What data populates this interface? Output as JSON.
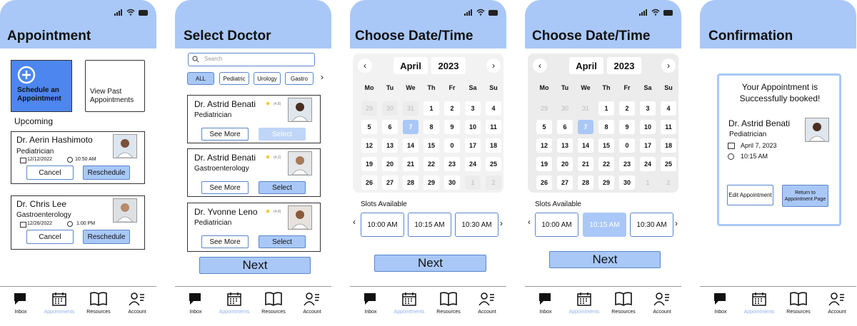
{
  "nav": [
    {
      "label": "Inbox",
      "icon": "inbox-icon"
    },
    {
      "label": "Appointments",
      "icon": "calendar-icon"
    },
    {
      "label": "Resources",
      "icon": "book-icon"
    },
    {
      "label": "Account",
      "icon": "account-icon"
    }
  ],
  "screen1": {
    "title": "Appointment",
    "schedule_label": "Schedule an Appointment",
    "past_label": "View Past Appointments",
    "upcoming_label": "Upcoming",
    "appointments": [
      {
        "doctor": "Dr. Aerin Hashimoto",
        "specialty": "Pediatrician",
        "date": "12/12/2022",
        "time": "10:50 AM",
        "cancel": "Cancel",
        "reschedule": "Reschedule"
      },
      {
        "doctor": "Dr. Chris Lee",
        "specialty": "Gastroenterology",
        "date": "12/26/2022",
        "time": "1:00 PM",
        "cancel": "Cancel",
        "reschedule": "Reschedule"
      }
    ]
  },
  "screen2": {
    "title": "Select Doctor",
    "search_placeholder": "Search",
    "filters": [
      "ALL",
      "Pediatric",
      "Urology",
      "Gastro"
    ],
    "doctors": [
      {
        "name": "Dr. Astrid Benati",
        "rating": "(4.8)",
        "specialty": "Pediatrician",
        "see_more": "See More",
        "select": "Select"
      },
      {
        "name": "Dr. Astrid Benati",
        "rating": "(4.2)",
        "specialty": "Gastroenterology",
        "see_more": "See More",
        "select": "Select"
      },
      {
        "name": "Dr. Yvonne Leno",
        "rating": "(4.8)",
        "specialty": "Pediatrician",
        "see_more": "See More",
        "select": "Select"
      }
    ],
    "next": "Next"
  },
  "calendar": {
    "title": "Choose Date/Time",
    "month": "April",
    "year": "2023",
    "weekdays": [
      "Mo",
      "Tu",
      "We",
      "Th",
      "Fr",
      "Sa",
      "Su"
    ],
    "weeks": [
      [
        "29",
        "30",
        "31",
        "1",
        "2",
        "3",
        "4"
      ],
      [
        "5",
        "6",
        "7",
        "8",
        "9",
        "10",
        "11"
      ],
      [
        "12",
        "13",
        "14",
        "15",
        "0",
        "17",
        "18"
      ],
      [
        "19",
        "20",
        "21",
        "22",
        "23",
        "24",
        "25"
      ],
      [
        "26",
        "27",
        "28",
        "29",
        "30",
        "1",
        "2"
      ]
    ],
    "slots_label": "Slots Available",
    "slots": [
      "10:00 AM",
      "10:15 AM",
      "10:30 AM"
    ],
    "next": "Next"
  },
  "screen5": {
    "title": "Confirmation",
    "message": "Your Appointment is Successfully booked!",
    "doctor": "Dr. Astrid Benati",
    "specialty": "Pediatrician",
    "date": "April 7, 2023",
    "time": "10:15 AM",
    "edit": "Edit Appointment",
    "return": "Return to Appointment Page"
  },
  "colors": {
    "accent": "#a9c8f7",
    "border": "#5a86c9",
    "active_nav": "#8fb3ea"
  }
}
